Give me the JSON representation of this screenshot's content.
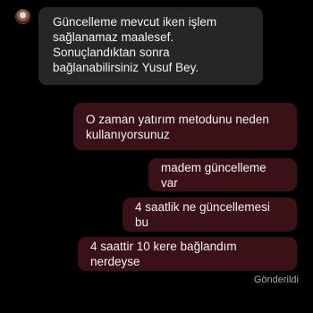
{
  "conversation": {
    "incoming": [
      {
        "lines": [
          "Güncelleme mevcut iken işlem",
          "sağlanamaz maalesef.",
          "Sonuçlandıktan sonra",
          "bağlanabilirsiniz Yusuf Bey."
        ]
      }
    ],
    "outgoing": [
      {
        "lines": [
          "O zaman yatırım metodunu neden",
          "kullanıyorsunuz"
        ]
      },
      {
        "text": "madem güncelleme var"
      },
      {
        "text": "4 saatlik ne güncellemesi bu"
      },
      {
        "text": "4 saattir 10 kere bağlandım nerdeyse"
      }
    ],
    "status": "Gönderildi"
  },
  "colors": {
    "background": "#000000",
    "incoming_bubble": "#262626",
    "outgoing_bubble": "#3a1116",
    "text": "#f2f2f2",
    "status_text": "#a8a8a8"
  }
}
